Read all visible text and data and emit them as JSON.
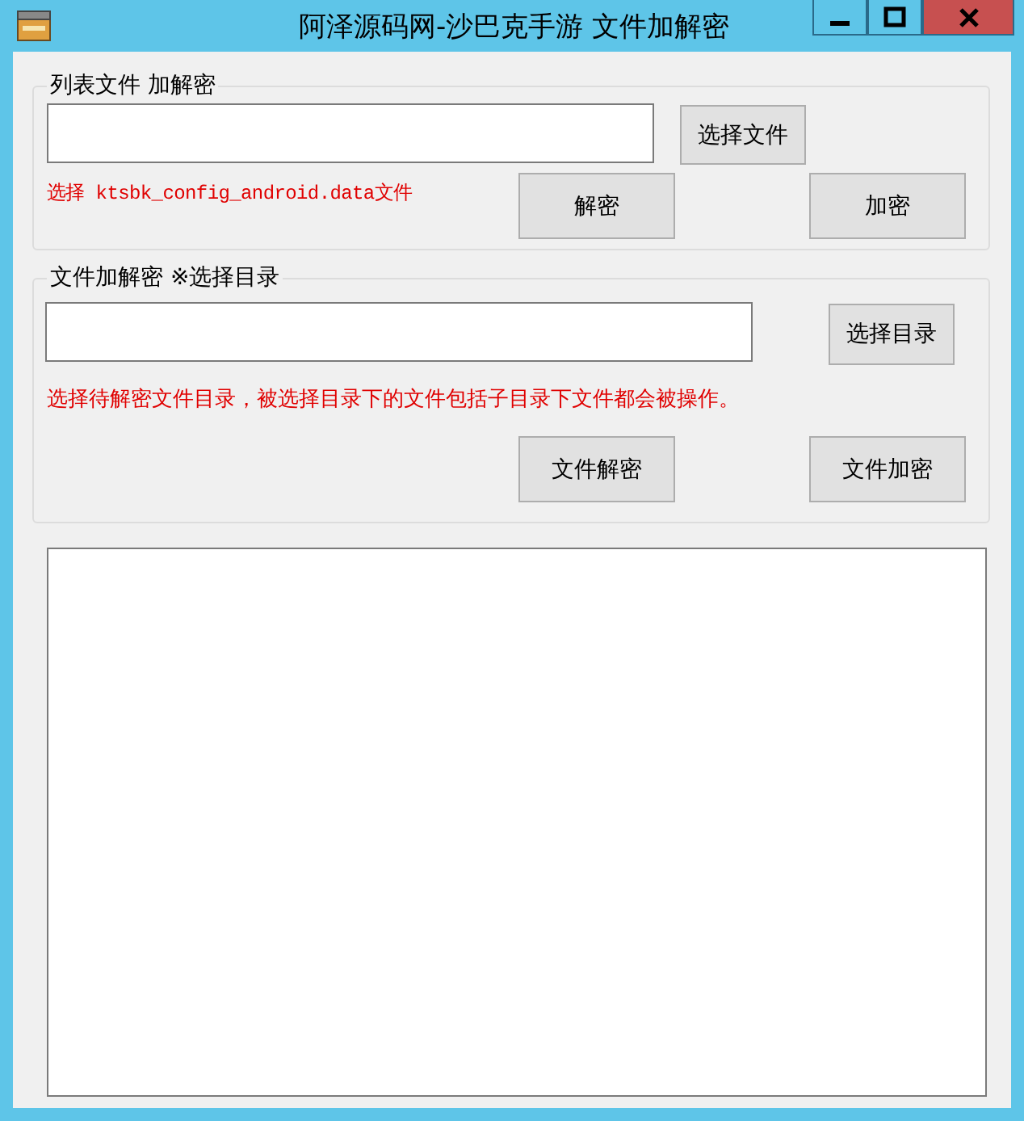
{
  "window": {
    "title": "阿泽源码网-沙巴克手游 文件加解密"
  },
  "list_group": {
    "legend": "列表文件 加解密",
    "select_button": "选择文件",
    "hint": "选择 ktsbk_config_android.data文件",
    "decrypt_button": "解密",
    "encrypt_button": "加密"
  },
  "folder_group": {
    "legend": "文件加解密 ※选择目录",
    "select_button": "选择目录",
    "hint": "选择待解密文件目录，被选择目录下的文件包括子目录下文件都会被操作。",
    "decrypt_button": "文件解密",
    "encrypt_button": "文件加密"
  }
}
